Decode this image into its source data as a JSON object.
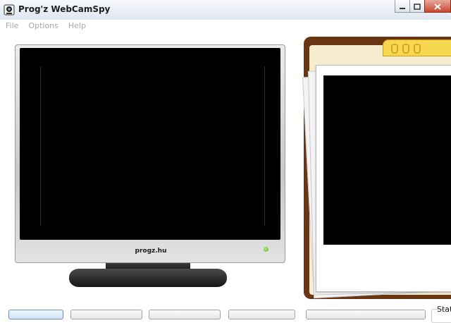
{
  "window": {
    "title": "Prog'z WebCamSpy"
  },
  "menu": {
    "items": [
      {
        "label": "File"
      },
      {
        "label": "Options"
      },
      {
        "label": "Help"
      }
    ]
  },
  "monitor": {
    "brand": "progz.hu"
  },
  "status": {
    "label": "Stat"
  },
  "colors": {
    "folder_edge": "#6a3512",
    "folder_tab": "#f7d74d",
    "led": "#54a820"
  }
}
